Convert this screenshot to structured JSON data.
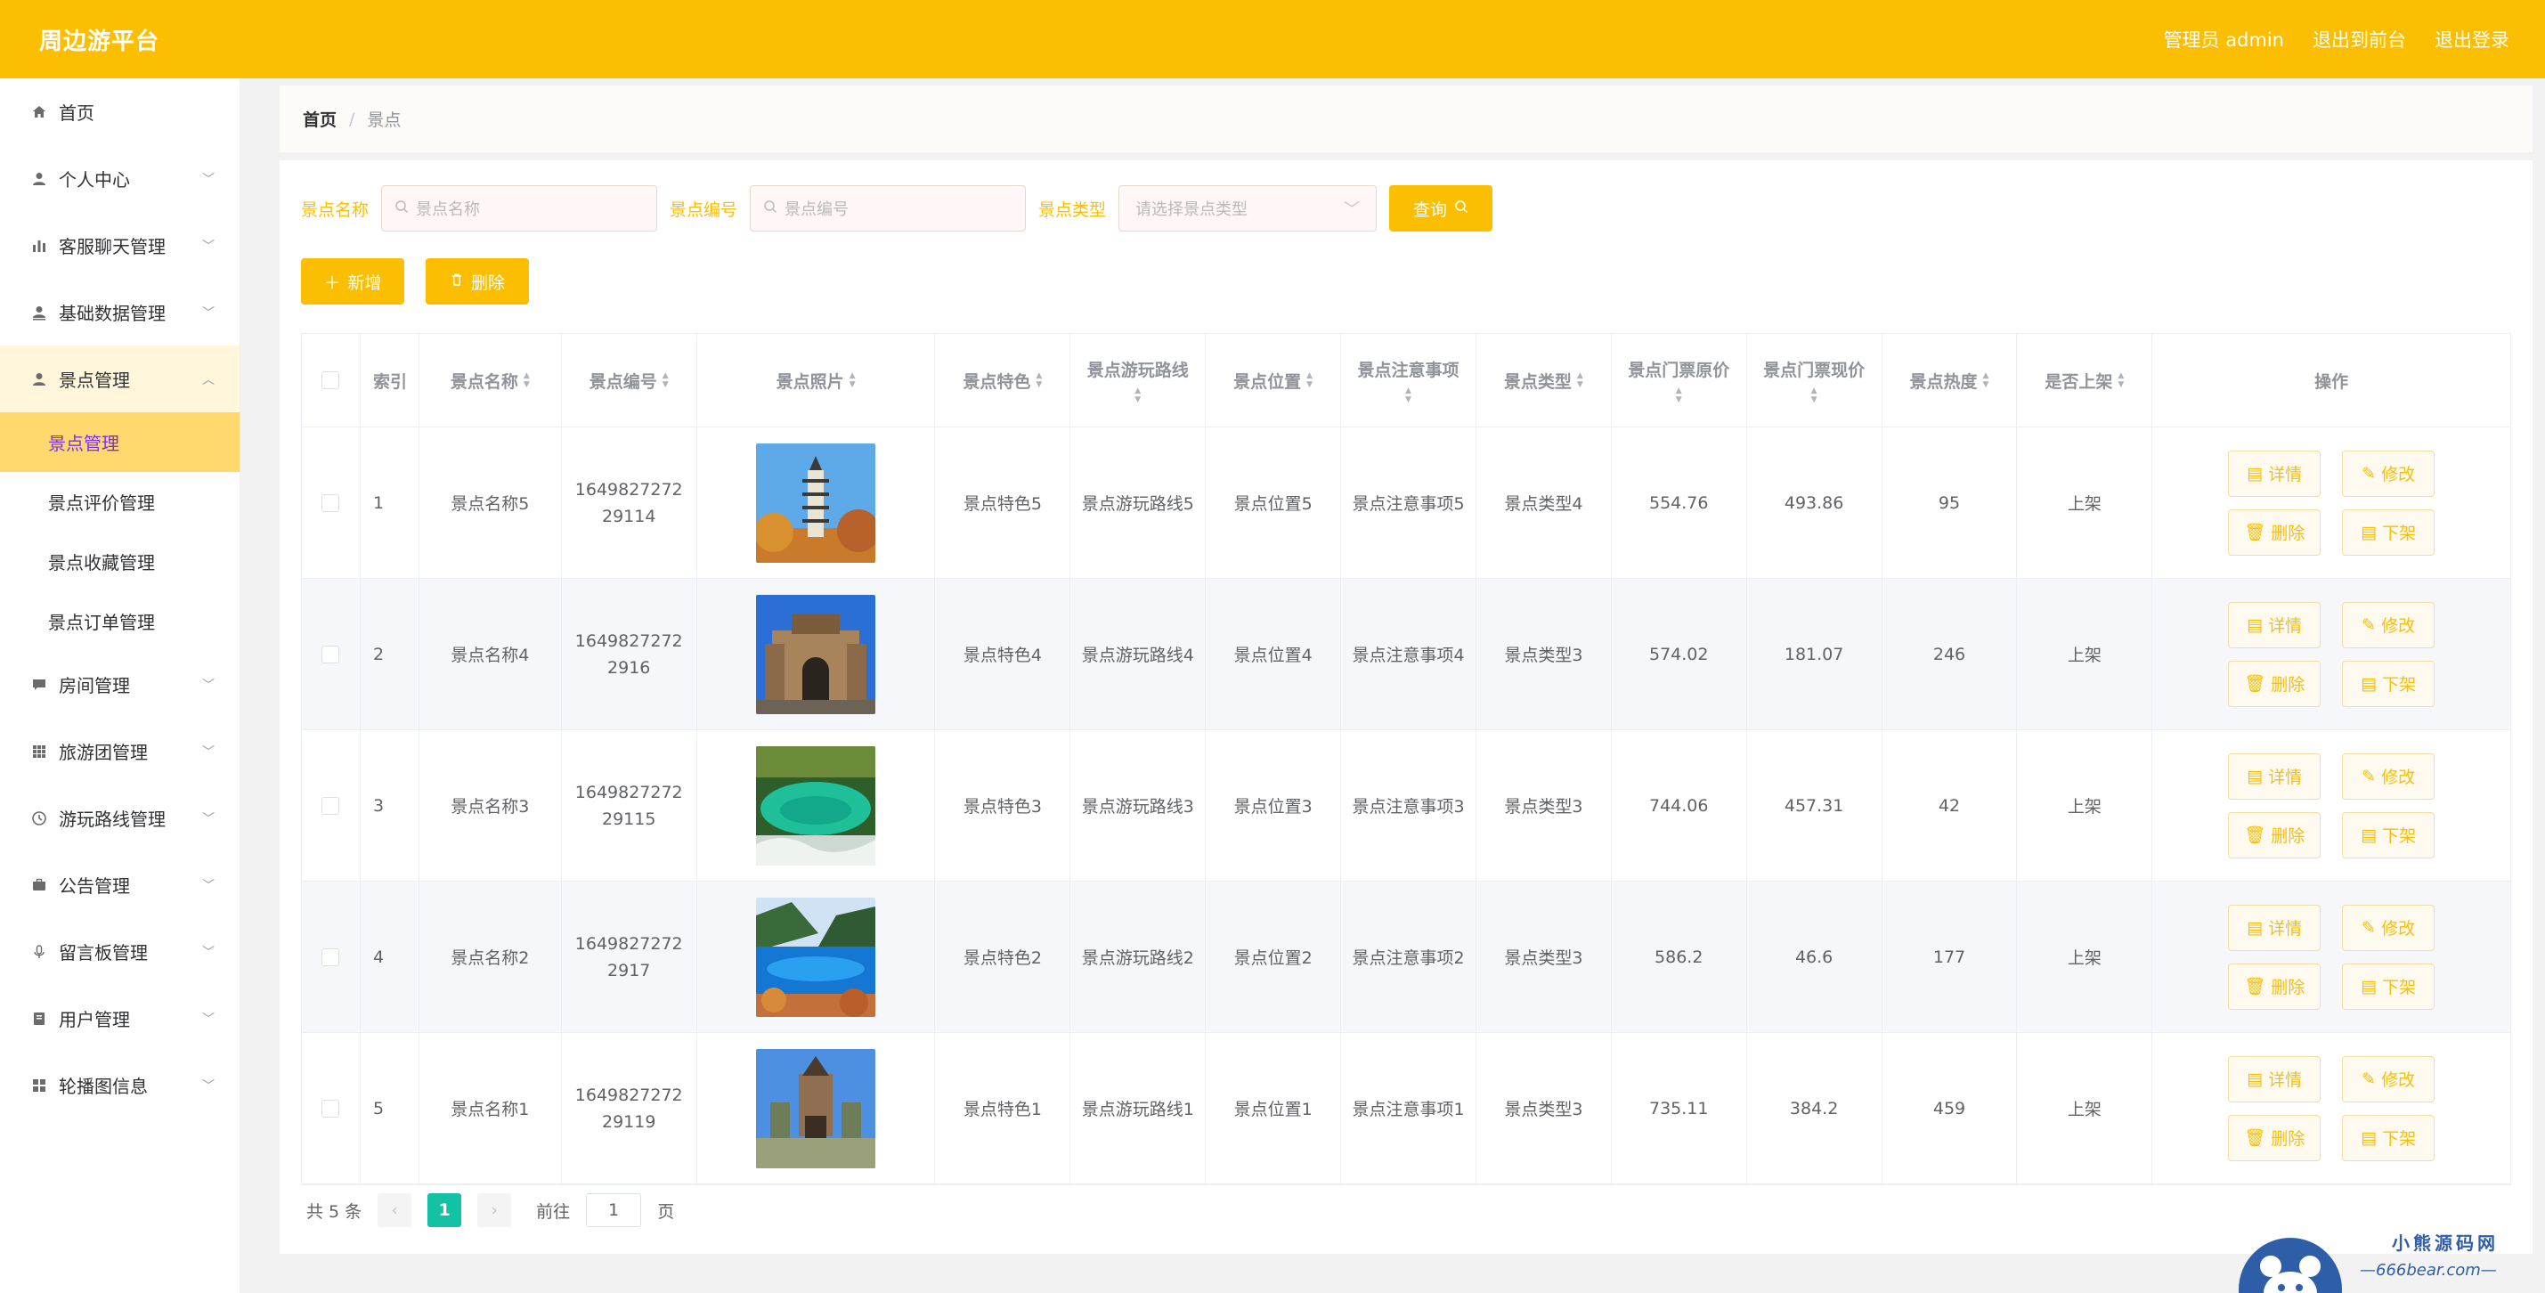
{
  "header": {
    "brand": "周边游平台",
    "admin_label": "管理员 admin",
    "front_label": "退出到前台",
    "logout_label": "退出登录"
  },
  "sidebar": {
    "items": [
      {
        "label": "首页",
        "icon": "home-icon"
      },
      {
        "label": "个人中心",
        "icon": "user-icon"
      },
      {
        "label": "客服聊天管理",
        "icon": "bar-chart-icon"
      },
      {
        "label": "基础数据管理",
        "icon": "user-upload-icon"
      },
      {
        "label": "景点管理",
        "icon": "user-icon"
      },
      {
        "label": "房间管理",
        "icon": "comment-icon"
      },
      {
        "label": "旅游团管理",
        "icon": "grid-icon"
      },
      {
        "label": "游玩路线管理",
        "icon": "clock-icon"
      },
      {
        "label": "公告管理",
        "icon": "briefcase-icon"
      },
      {
        "label": "留言板管理",
        "icon": "microphone-icon"
      },
      {
        "label": "用户管理",
        "icon": "notebook-icon"
      },
      {
        "label": "轮播图信息",
        "icon": "apps-icon"
      }
    ],
    "sub_items": [
      "景点管理",
      "景点评价管理",
      "景点收藏管理",
      "景点订单管理"
    ]
  },
  "breadcrumb": {
    "home": "首页",
    "separator": "/",
    "current": "景点"
  },
  "search": {
    "name_label": "景点名称",
    "name_placeholder": "景点名称",
    "code_label": "景点编号",
    "code_placeholder": "景点编号",
    "type_label": "景点类型",
    "type_placeholder": "请选择景点类型",
    "query_label": "查询"
  },
  "actions": {
    "add_label": "新增",
    "delete_label": "删除"
  },
  "table": {
    "headers": [
      "索引",
      "景点名称",
      "景点编号",
      "景点照片",
      "景点特色",
      "景点游玩路线",
      "景点位置",
      "景点注意事项",
      "景点类型",
      "景点门票原价",
      "景点门票现价",
      "景点热度",
      "是否上架",
      "操作"
    ],
    "rows": [
      {
        "index": "1",
        "name": "景点名称5",
        "code": "164982727229114",
        "feature": "景点特色5",
        "route": "景点游玩路线5",
        "location": "景点位置5",
        "notice": "景点注意事项5",
        "type": "景点类型4",
        "orig_price": "554.76",
        "cur_price": "493.86",
        "heat": "95",
        "status": "上架",
        "photo": "pagoda"
      },
      {
        "index": "2",
        "name": "景点名称4",
        "code": "16498272722916",
        "feature": "景点特色4",
        "route": "景点游玩路线4",
        "location": "景点位置4",
        "notice": "景点注意事项4",
        "type": "景点类型3",
        "orig_price": "574.02",
        "cur_price": "181.07",
        "heat": "246",
        "status": "上架",
        "photo": "gate"
      },
      {
        "index": "3",
        "name": "景点名称3",
        "code": "164982727229115",
        "feature": "景点特色3",
        "route": "景点游玩路线3",
        "location": "景点位置3",
        "notice": "景点注意事项3",
        "type": "景点类型3",
        "orig_price": "744.06",
        "cur_price": "457.31",
        "heat": "42",
        "status": "上架",
        "photo": "lake"
      },
      {
        "index": "4",
        "name": "景点名称2",
        "code": "16498272722917",
        "feature": "景点特色2",
        "route": "景点游玩路线2",
        "location": "景点位置2",
        "notice": "景点注意事项2",
        "type": "景点类型3",
        "orig_price": "586.2",
        "cur_price": "46.6",
        "heat": "177",
        "status": "上架",
        "photo": "blue-lake"
      },
      {
        "index": "5",
        "name": "景点名称1",
        "code": "164982727229119",
        "feature": "景点特色1",
        "route": "景点游玩路线1",
        "location": "景点位置1",
        "notice": "景点注意事项1",
        "type": "景点类型3",
        "orig_price": "735.11",
        "cur_price": "384.2",
        "heat": "459",
        "status": "上架",
        "photo": "castle"
      }
    ],
    "op_labels": {
      "detail": "详情",
      "edit": "修改",
      "delete": "删除",
      "off": "下架"
    }
  },
  "pager": {
    "total": "共 5 条",
    "page": "1",
    "goto": "前往",
    "page_input": "1",
    "page_suffix": "页"
  },
  "watermark": {
    "line1": "小熊源码网",
    "line2": "—666bear.com—"
  },
  "colors": {
    "accent": "#fcbe00",
    "page_active": "#13c2a3",
    "submenu_active": "#ffd86e"
  }
}
